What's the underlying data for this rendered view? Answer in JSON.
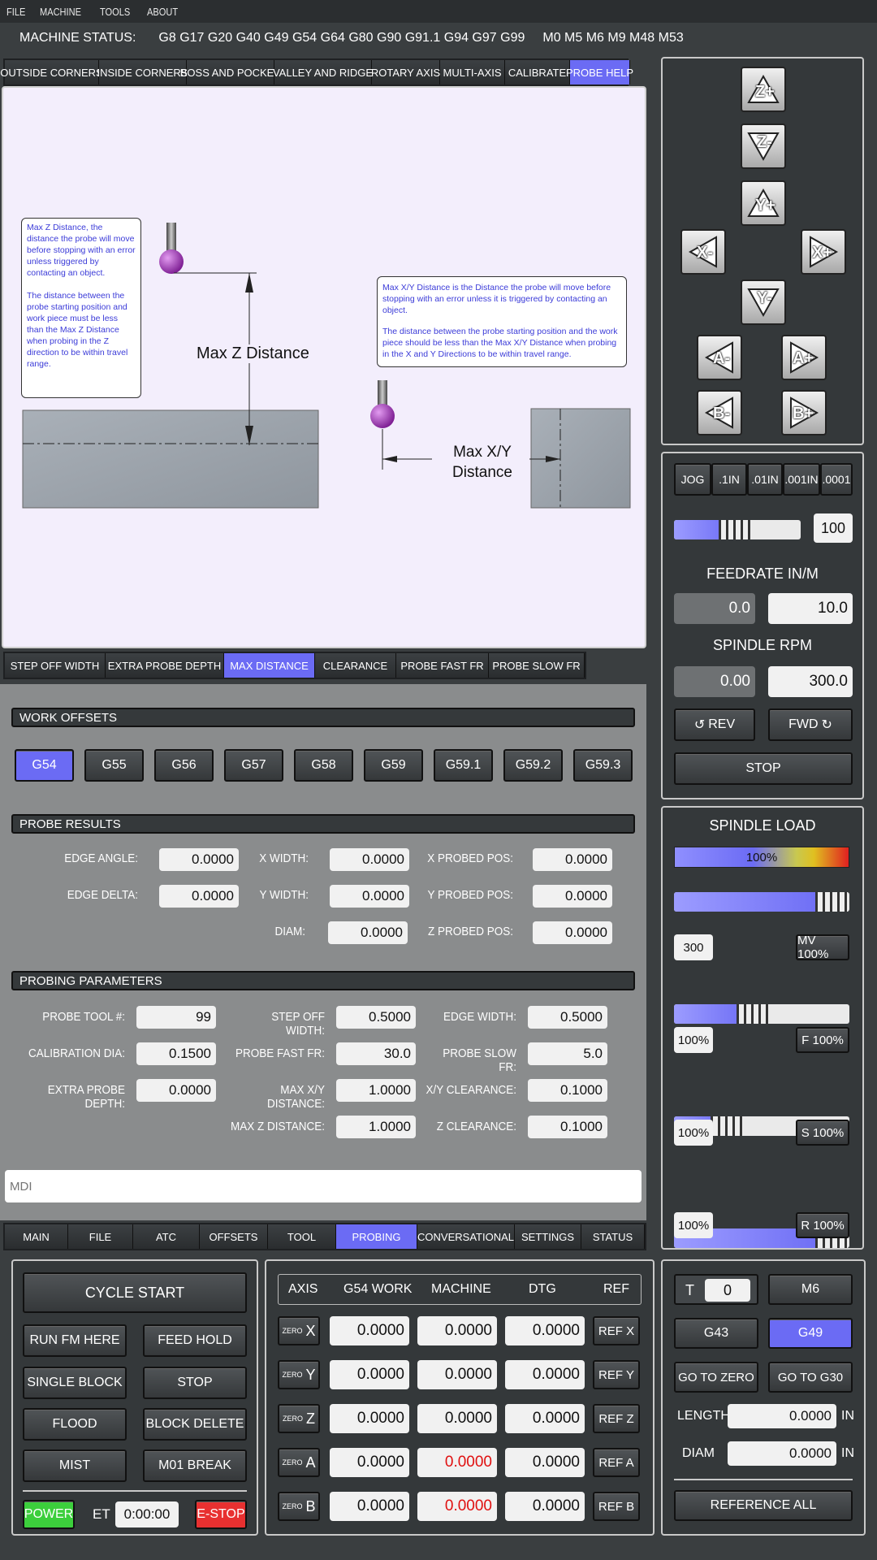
{
  "menu": [
    "FILE",
    "MACHINE",
    "TOOLS",
    "ABOUT"
  ],
  "status": {
    "label": "MACHINE STATUS:",
    "gcodes": "G8 G17 G20 G40 G49 G54 G64 G80 G90 G91.1 G94 G97 G99",
    "mcodes": "M0 M5 M6 M9 M48 M53"
  },
  "top_tabs": [
    "OUTSIDE CORNERS",
    "INSIDE CORNERS",
    "BOSS AND POCKET",
    "VALLEY AND RIDGE",
    "ROTARY AXIS",
    "MULTI-AXIS",
    "CALIBRATE",
    "PROBE HELP"
  ],
  "help": {
    "z_note_1": "Max Z Distance, the distance the probe will move before stopping with an error unless triggered by contacting an object.",
    "z_note_2": "The distance between the probe starting position and work piece must be less than the Max Z Distance when probing in the Z direction to be within travel range.",
    "z_label": "Max Z Distance",
    "xy_note_1": "Max X/Y Distance is the Distance the probe will move before stopping with an error unless it is triggered by contacting an object.",
    "xy_note_2": "The distance between the probe starting position and the work piece should be less than the Max X/Y Distance when probing in the X and Y Directions to be within travel range.",
    "xy_label_1": "Max X/Y",
    "xy_label_2": "Distance"
  },
  "help_tabs": [
    "STEP OFF WIDTH",
    "EXTRA PROBE DEPTH",
    "MAX DISTANCE",
    "CLEARANCE",
    "PROBE FAST FR",
    "PROBE SLOW FR"
  ],
  "work_offsets": {
    "title": "WORK OFFSETS",
    "items": [
      "G54",
      "G55",
      "G56",
      "G57",
      "G58",
      "G59",
      "G59.1",
      "G59.2",
      "G59.3"
    ]
  },
  "probe_results": {
    "title": "PROBE RESULTS",
    "edge_angle": "EDGE ANGLE:",
    "edge_angle_v": "0.0000",
    "edge_delta": "EDGE DELTA:",
    "edge_delta_v": "0.0000",
    "x_width": "X WIDTH:",
    "x_width_v": "0.0000",
    "y_width": "Y WIDTH:",
    "y_width_v": "0.0000",
    "diam": "DIAM:",
    "diam_v": "0.0000",
    "x_probed": "X PROBED POS:",
    "x_probed_v": "0.0000",
    "y_probed": "Y PROBED POS:",
    "y_probed_v": "0.0000",
    "z_probed": "Z PROBED POS:",
    "z_probed_v": "0.0000"
  },
  "probing_params": {
    "title": "PROBING PARAMETERS",
    "tool": "PROBE TOOL #:",
    "tool_v": "99",
    "cal": "CALIBRATION DIA:",
    "cal_v": "0.1500",
    "extra": "EXTRA PROBE DEPTH:",
    "extra_v": "0.0000",
    "stepoff": "STEP OFF WIDTH:",
    "stepoff_v": "0.5000",
    "fast": "PROBE FAST FR:",
    "fast_v": "30.0",
    "maxxy": "MAX X/Y DISTANCE:",
    "maxxy_v": "1.0000",
    "maxz": "MAX Z DISTANCE:",
    "maxz_v": "1.0000",
    "edge": "EDGE WIDTH:",
    "edge_v": "0.5000",
    "slow": "PROBE SLOW FR:",
    "slow_v": "5.0",
    "xyclr": "X/Y CLEARANCE:",
    "xyclr_v": "0.1000",
    "zclr": "Z CLEARANCE:",
    "zclr_v": "0.1000"
  },
  "mdi": {
    "placeholder": "MDI"
  },
  "bottom_tabs": [
    "MAIN",
    "FILE",
    "ATC",
    "OFFSETS",
    "TOOL",
    "PROBING",
    "CONVERSATIONAL",
    "SETTINGS",
    "STATUS"
  ],
  "controls": {
    "cycle_start": "CYCLE START",
    "run_here": "RUN FM HERE",
    "feed_hold": "FEED HOLD",
    "single_block": "SINGLE BLOCK",
    "stop": "STOP",
    "flood": "FLOOD",
    "block_delete": "BLOCK DELETE",
    "mist": "MIST",
    "m01": "M01 BREAK",
    "power": "POWER",
    "et": "ET",
    "et_v": "0:00:00",
    "estop": "E-STOP"
  },
  "dro": {
    "headers": [
      "AXIS",
      "G54 WORK",
      "MACHINE",
      "DTG",
      "REF"
    ],
    "zero": "ZERO",
    "rows": [
      {
        "axis": "X",
        "work": "0.0000",
        "machine": "0.0000",
        "dtg": "0.0000",
        "ref": "REF X"
      },
      {
        "axis": "Y",
        "work": "0.0000",
        "machine": "0.0000",
        "dtg": "0.0000",
        "ref": "REF Y"
      },
      {
        "axis": "Z",
        "work": "0.0000",
        "machine": "0.0000",
        "dtg": "0.0000",
        "ref": "REF Z"
      },
      {
        "axis": "A",
        "work": "0.0000",
        "machine": "0.0000",
        "dtg": "0.0000",
        "ref": "REF A"
      },
      {
        "axis": "B",
        "work": "0.0000",
        "machine": "0.0000",
        "dtg": "0.0000",
        "ref": "REF B"
      }
    ]
  },
  "tool_panel": {
    "t": "T",
    "t_v": "0",
    "m6": "M6",
    "g43": "G43",
    "g49": "G49",
    "go_zero": "GO TO ZERO",
    "go_g30": "GO TO G30",
    "length": "LENGTH",
    "length_v": "0.0000",
    "in": "IN",
    "diam": "DIAM",
    "diam_v": "0.0000",
    "ref_all": "REFERENCE ALL"
  },
  "jog": {
    "zp": "Z+",
    "zm": "Z-",
    "yp": "Y+",
    "ym": "Y-",
    "xm": "X-",
    "xp": "X+",
    "am": "A-",
    "ap": "A+",
    "bm": "B-",
    "bp": "B+",
    "steps": [
      "JOG",
      ".1IN",
      ".01IN",
      ".001IN",
      ".0001"
    ],
    "jog_pct": "100",
    "jog_level": 0.48
  },
  "feed": {
    "title": "FEEDRATE IN/M",
    "actual": "0.0",
    "set": "10.0"
  },
  "spindle": {
    "title": "SPINDLE RPM",
    "actual": "0.00",
    "set": "300.0",
    "rev": "REV",
    "fwd": "FWD",
    "stop": "STOP"
  },
  "load": {
    "title": "SPINDLE LOAD",
    "pct": "100%",
    "mv_val": "300",
    "mv": "MV 100%",
    "f_val": "100%",
    "f": "F 100%",
    "s_val": "100%",
    "s": "S 100%",
    "r_val": "100%",
    "r": "R 100%",
    "levels": [
      0.9,
      0.45,
      0.3,
      0.9
    ]
  },
  "colors": {
    "accent": "#6b6bf4",
    "power": "#3ccf3c",
    "estop": "#e83030",
    "red_value": "#e01010"
  }
}
